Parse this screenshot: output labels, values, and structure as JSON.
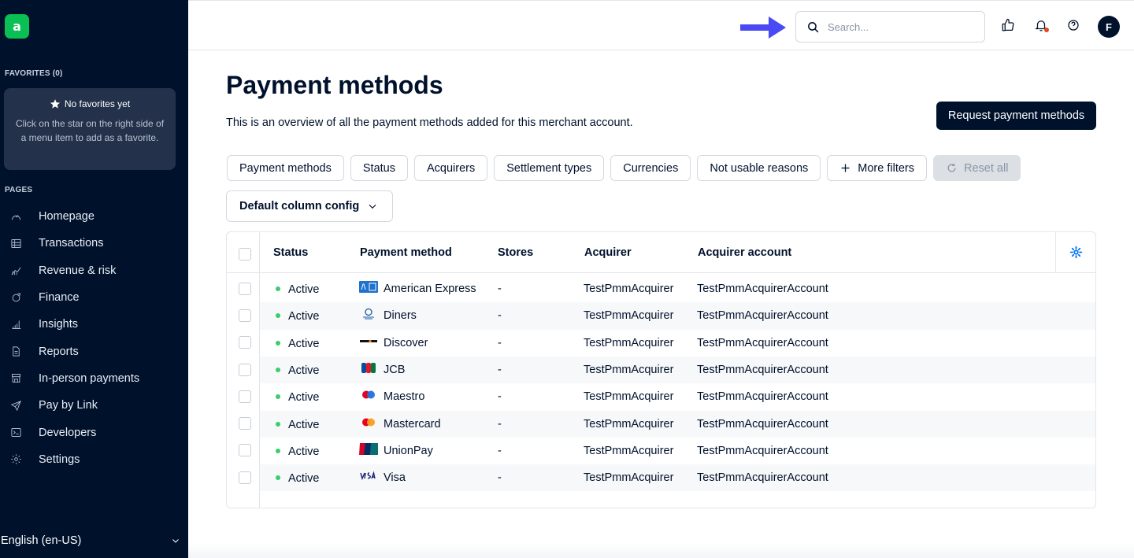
{
  "sidebar": {
    "logo_letter": "a",
    "favorites_label": "FAVORITES (0)",
    "favorites_title": "No favorites yet",
    "favorites_text": "Click on the star on the right side of a menu item to add as a favorite.",
    "pages_label": "PAGES",
    "items": [
      {
        "label": "Homepage",
        "icon": "home-icon"
      },
      {
        "label": "Transactions",
        "icon": "table-icon"
      },
      {
        "label": "Revenue & risk",
        "icon": "chart-icon"
      },
      {
        "label": "Finance",
        "icon": "finance-icon"
      },
      {
        "label": "Insights",
        "icon": "bar-chart-icon"
      },
      {
        "label": "Reports",
        "icon": "report-icon"
      },
      {
        "label": "In-person payments",
        "icon": "store-icon"
      },
      {
        "label": "Pay by Link",
        "icon": "rocket-icon"
      },
      {
        "label": "Developers",
        "icon": "terminal-icon"
      },
      {
        "label": "Settings",
        "icon": "gear-icon"
      }
    ],
    "language": "English (en-US)"
  },
  "topbar": {
    "search_placeholder": "Search...",
    "avatar_initial": "F",
    "arrow_color": "#4a4af4"
  },
  "main": {
    "title": "Payment methods",
    "subtitle": "This is an overview of all the payment methods added for this merchant account.",
    "request_button": "Request payment methods",
    "filters": [
      "Payment methods",
      "Status",
      "Acquirers",
      "Settlement types",
      "Currencies",
      "Not usable reasons"
    ],
    "more_filters": "More filters",
    "reset_all": "Reset all",
    "column_config": "Default column config"
  },
  "table": {
    "headers": {
      "status": "Status",
      "payment_method": "Payment method",
      "stores": "Stores",
      "acquirer": "Acquirer",
      "acquirer_account": "Acquirer account"
    },
    "rows": [
      {
        "status": "Active",
        "method": "American Express",
        "icon": "amex-icon",
        "stores": "-",
        "acquirer": "TestPmmAcquirer",
        "account": "TestPmmAcquirerAccount"
      },
      {
        "status": "Active",
        "method": "Diners",
        "icon": "diners-icon",
        "stores": "-",
        "acquirer": "TestPmmAcquirer",
        "account": "TestPmmAcquirerAccount"
      },
      {
        "status": "Active",
        "method": "Discover",
        "icon": "discover-icon",
        "stores": "-",
        "acquirer": "TestPmmAcquirer",
        "account": "TestPmmAcquirerAccount"
      },
      {
        "status": "Active",
        "method": "JCB",
        "icon": "jcb-icon",
        "stores": "-",
        "acquirer": "TestPmmAcquirer",
        "account": "TestPmmAcquirerAccount"
      },
      {
        "status": "Active",
        "method": "Maestro",
        "icon": "maestro-icon",
        "stores": "-",
        "acquirer": "TestPmmAcquirer",
        "account": "TestPmmAcquirerAccount"
      },
      {
        "status": "Active",
        "method": "Mastercard",
        "icon": "mastercard-icon",
        "stores": "-",
        "acquirer": "TestPmmAcquirer",
        "account": "TestPmmAcquirerAccount"
      },
      {
        "status": "Active",
        "method": "UnionPay",
        "icon": "unionpay-icon",
        "stores": "-",
        "acquirer": "TestPmmAcquirer",
        "account": "TestPmmAcquirerAccount"
      },
      {
        "status": "Active",
        "method": "Visa",
        "icon": "visa-icon",
        "stores": "-",
        "acquirer": "TestPmmAcquirer",
        "account": "TestPmmAcquirerAccount"
      }
    ]
  },
  "colors": {
    "sidebar_bg": "#00112c",
    "brand_green": "#0abf53",
    "status_active": "#3ccb6f",
    "accent_blue": "#0070f5"
  }
}
